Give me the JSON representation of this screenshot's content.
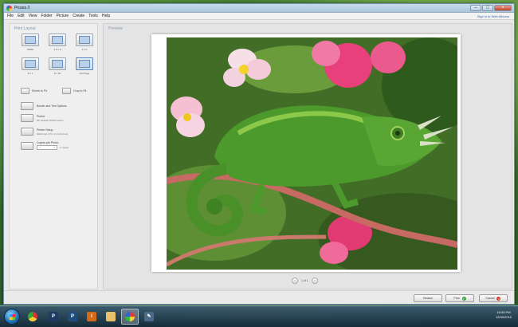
{
  "window": {
    "title": "Picasa 3",
    "signin": "Sign in to Web Albums"
  },
  "menu": [
    "File",
    "Edit",
    "View",
    "Folder",
    "Picture",
    "Create",
    "Tools",
    "Help"
  ],
  "print_layout": {
    "title": "Print Layout",
    "layouts": [
      {
        "label": "Wallet"
      },
      {
        "label": "3.5 x 5"
      },
      {
        "label": "4 x 6"
      },
      {
        "label": "5 x 7"
      },
      {
        "label": "8 x 10"
      },
      {
        "label": "Full Page"
      }
    ],
    "shrink_label": "Shrink to Fit",
    "crop_label": "Crop to Fit",
    "border_label": "Border and Text Options",
    "printer_label": "Printer:",
    "printer_name": "HP Deskjet D1600 series",
    "printer_setup_label": "Printer Setup",
    "printer_setup_value": "600x0 dpi, 8.5 x 11.0 (Inches)",
    "copies_label": "Copies per Photo:",
    "copies_value": "1 copies"
  },
  "preview": {
    "title": "Preview",
    "page_indicator": "1 of 1"
  },
  "footer": {
    "review_label": "Review",
    "print_label": "Print",
    "cancel_label": "Cancel"
  },
  "taskbar": {
    "time": "10:05 PM",
    "date": "12/30/2010"
  },
  "icons": {
    "print": "check-icon",
    "cancel": "close-icon"
  }
}
